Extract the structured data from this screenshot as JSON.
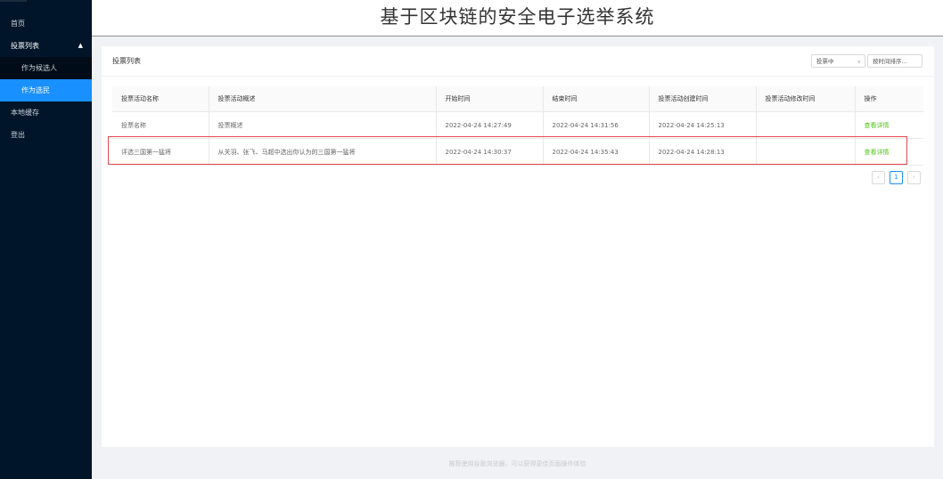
{
  "app": {
    "title": "基于区块链的安全电子选举系统"
  },
  "sidebar": {
    "items": [
      {
        "label": "首页"
      },
      {
        "label": "投票列表",
        "chevron": "chevron-up-icon"
      },
      {
        "label": "作为候选人"
      },
      {
        "label": "作为选民"
      },
      {
        "label": "本地缓存"
      },
      {
        "label": "登出"
      }
    ]
  },
  "card": {
    "title": "投票列表",
    "status_select": {
      "value": "投票中"
    },
    "sort_select": {
      "value": "按时间排序..."
    }
  },
  "table": {
    "columns": [
      "投票活动名称",
      "投票活动概述",
      "开始时间",
      "结束时间",
      "投票活动创建时间",
      "投票活动修改时间",
      "操作"
    ],
    "rows": [
      {
        "name": "投票名称",
        "desc": "投票概述",
        "start": "2022-04-24 14:27:49",
        "end": "2022-04-24 14:31:56",
        "created": "2022-04-24 14:25:13",
        "modified": "",
        "action": "查看详情"
      },
      {
        "name": "评选三国第一猛将",
        "desc": "从关羽、张飞、马超中选出你认为的三国第一猛将",
        "start": "2022-04-24 14:30:37",
        "end": "2022-04-24 14:35:43",
        "created": "2022-04-24 14:28:13",
        "modified": "",
        "action": "查看详情"
      }
    ]
  },
  "pagination": {
    "prev": "‹",
    "current": "1",
    "next": "›"
  },
  "footer": {
    "text": "推荐使用谷歌浏览器，可以获得更佳页面操作体验"
  },
  "colors": {
    "sidebar": "#001529",
    "active": "#1890ff",
    "action": "#52c41a",
    "highlight": "#e5484d"
  }
}
